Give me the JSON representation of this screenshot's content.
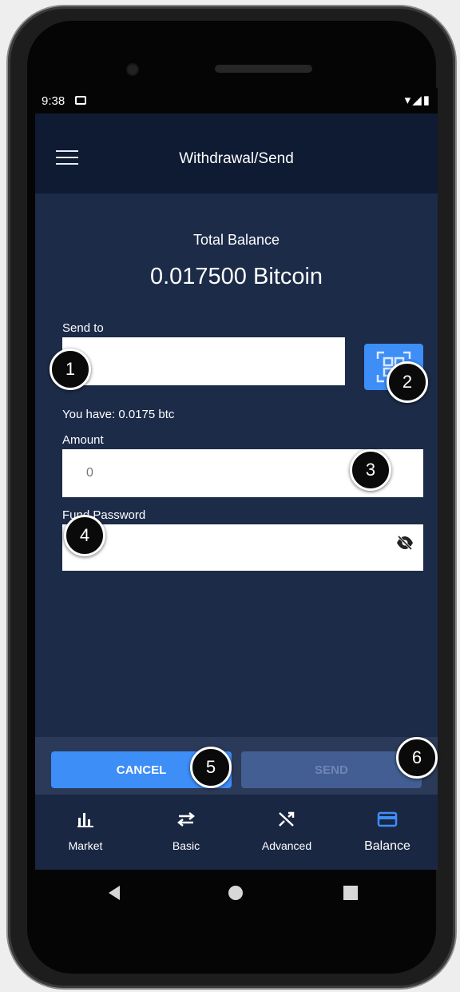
{
  "status_bar": {
    "time": "9:38",
    "icons": "▾◢▮"
  },
  "app_bar": {
    "title": "Withdrawal/Send"
  },
  "balance": {
    "label": "Total Balance",
    "value": "0.017500 Bitcoin"
  },
  "form": {
    "send_to_label": "Send to",
    "send_to_value": "",
    "you_have_text": "You have: 0.0175 btc",
    "amount_label": "Amount",
    "amount_value": "0",
    "fund_password_label": "Fund Password",
    "fund_password_value": ""
  },
  "actions": {
    "cancel_label": "CANCEL",
    "send_label": "SEND"
  },
  "bottom_nav": {
    "items": [
      {
        "label": "Market",
        "icon": "bar-chart-icon"
      },
      {
        "label": "Basic",
        "icon": "swap-arrows-icon"
      },
      {
        "label": "Advanced",
        "icon": "shuffle-icon"
      },
      {
        "label": "Balance",
        "icon": "wallet-card-icon",
        "active": true
      }
    ]
  },
  "callouts": [
    "1",
    "2",
    "3",
    "4",
    "5",
    "6"
  ],
  "colors": {
    "accent": "#3d8ef7",
    "background": "#1c2b48",
    "app_bar": "#0f1b33"
  }
}
